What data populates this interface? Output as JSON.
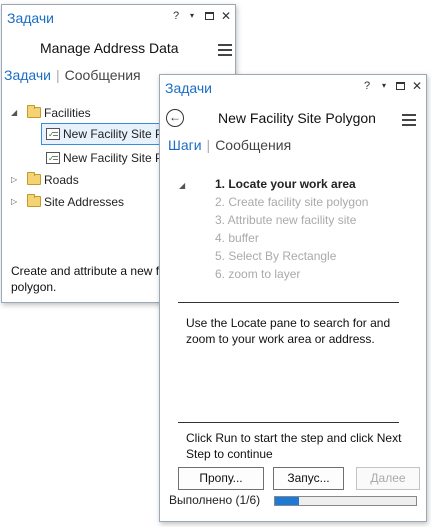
{
  "back_pane": {
    "window_title": "Задачи",
    "help_label": "?",
    "caret_label": "▾",
    "close_label": "✕",
    "task_title": "Manage Address Data",
    "tabs": {
      "active": "Задачи",
      "inactive": "Сообщения"
    },
    "tree": [
      {
        "label": "Facilities",
        "expanded": true,
        "kind": "folder"
      },
      {
        "label": "New Facility Site P",
        "kind": "task",
        "selected": true
      },
      {
        "label": "New Facility Site P",
        "kind": "task",
        "selected": false
      },
      {
        "label": "Roads",
        "expanded": false,
        "kind": "folder"
      },
      {
        "label": "Site Addresses",
        "expanded": false,
        "kind": "folder"
      }
    ],
    "description": "Create and attribute a new f\npolygon."
  },
  "front_pane": {
    "window_title": "Задачи",
    "help_label": "?",
    "caret_label": "▾",
    "close_label": "✕",
    "task_title": "New Facility Site Polygon",
    "tabs": {
      "active": "Шаги",
      "inactive": "Сообщения"
    },
    "steps": [
      {
        "label": "1.  Locate your work area",
        "active": true
      },
      {
        "label": "2.  Create facility site  polygon",
        "active": false
      },
      {
        "label": "3.  Attribute new facility site",
        "active": false
      },
      {
        "label": "4.  buffer",
        "active": false
      },
      {
        "label": "5.  Select By Rectangle",
        "active": false
      },
      {
        "label": "6.  zoom to layer",
        "active": false
      }
    ],
    "step_description": "Use the Locate pane to search for and\nzoom to your work area or address.",
    "step_instruction": "Click Run to start the step and click Next\nStep to continue",
    "buttons": {
      "skip": "Пропу...",
      "run": "Запус...",
      "next": "Далее"
    },
    "status": {
      "label": "Выполнено  (1/6)",
      "progress": 0.1667
    }
  },
  "colors": {
    "accent": "#1a6ec4",
    "progress": "#1e7ad2",
    "folder": "#f3d374"
  }
}
